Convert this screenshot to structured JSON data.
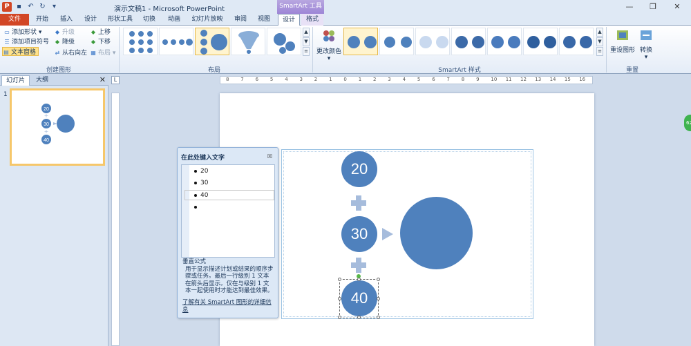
{
  "window": {
    "title": "演示文稿1 - Microsoft PowerPoint",
    "context_group": "SmartArt 工具",
    "app_icon": "P"
  },
  "tabs": [
    {
      "label": "文件"
    },
    {
      "label": "开始"
    },
    {
      "label": "插入"
    },
    {
      "label": "设计"
    },
    {
      "label": "形状工具"
    },
    {
      "label": "切换"
    },
    {
      "label": "动画"
    },
    {
      "label": "幻灯片放映"
    },
    {
      "label": "审阅"
    },
    {
      "label": "视图"
    },
    {
      "label": "设计"
    },
    {
      "label": "格式"
    }
  ],
  "ribbon": {
    "create_graphic": {
      "label": "创建图形",
      "add_shape": "添加形状",
      "add_bullet": "添加项目符号",
      "text_pane": "文本窗格",
      "promote": "升级",
      "demote": "降级",
      "right_to_left": "从右向左",
      "move_up": "上移",
      "move_down": "下移",
      "layout_btn": "布局"
    },
    "layouts": {
      "label": "布局"
    },
    "change_colors": "更改颜色",
    "styles": {
      "label": "SmartArt 样式"
    },
    "reset": {
      "label": "重置",
      "reset_graphic": "重设图形",
      "convert": "转换"
    }
  },
  "left_pane": {
    "tab_slides": "幻灯片",
    "tab_outline": "大纲",
    "close": "✕",
    "slide_number": "1",
    "thumb_values": [
      "20",
      "30",
      "40"
    ]
  },
  "ruler": {
    "h_labels": [
      "8",
      "7",
      "6",
      "5",
      "4",
      "3",
      "2",
      "1",
      "0",
      "1",
      "2",
      "3",
      "4",
      "5",
      "6",
      "7",
      "8",
      "9",
      "10",
      "11",
      "12",
      "13",
      "14",
      "15",
      "16"
    ],
    "corner": "L"
  },
  "text_pane": {
    "title": "在此处键入文字",
    "close": "☒",
    "items": [
      "20",
      "30",
      "40",
      ""
    ],
    "desc_title": "垂直公式",
    "description": "用于显示描述计划或结果的顺序步骤或任务。最后一行级别 1 文本在箭头后显示。仅在与级别 1 文本一起使用时才能达到最佳效果。",
    "link": "了解有关 SmartArt 图形的详细信息"
  },
  "smartart": {
    "values": [
      "20",
      "30",
      "40"
    ],
    "result": ""
  },
  "side_badge": "62",
  "colors": {
    "accent": "#4f81bd",
    "connector": "#a6bcdc",
    "file_tab": "#d24726",
    "context_tab": "#9d85d6"
  }
}
